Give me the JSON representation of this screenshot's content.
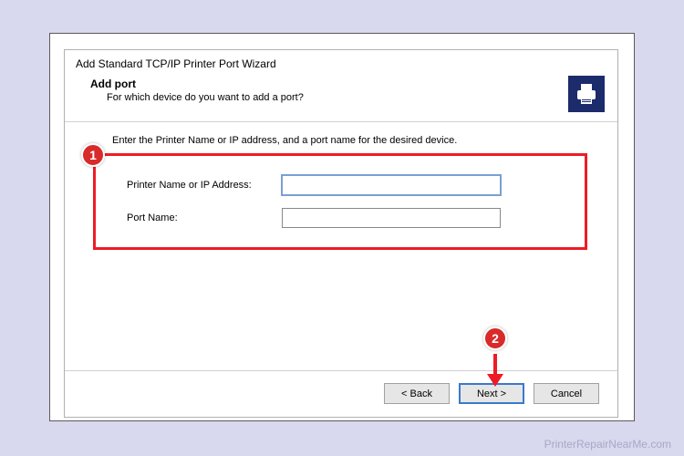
{
  "dialog": {
    "title": "Add Standard TCP/IP Printer Port Wizard",
    "header_title": "Add port",
    "header_sub": "For which device do you want to add a port?",
    "instruction": "Enter the Printer Name or IP address, and a port name for the desired device."
  },
  "form": {
    "ip_label": "Printer Name or IP Address:",
    "ip_value": "",
    "port_label": "Port Name:",
    "port_value": ""
  },
  "buttons": {
    "back": "< Back",
    "next": "Next >",
    "cancel": "Cancel"
  },
  "annotations": {
    "badge1": "1",
    "badge2": "2"
  },
  "watermark": "PrinterRepairNearMe.com"
}
